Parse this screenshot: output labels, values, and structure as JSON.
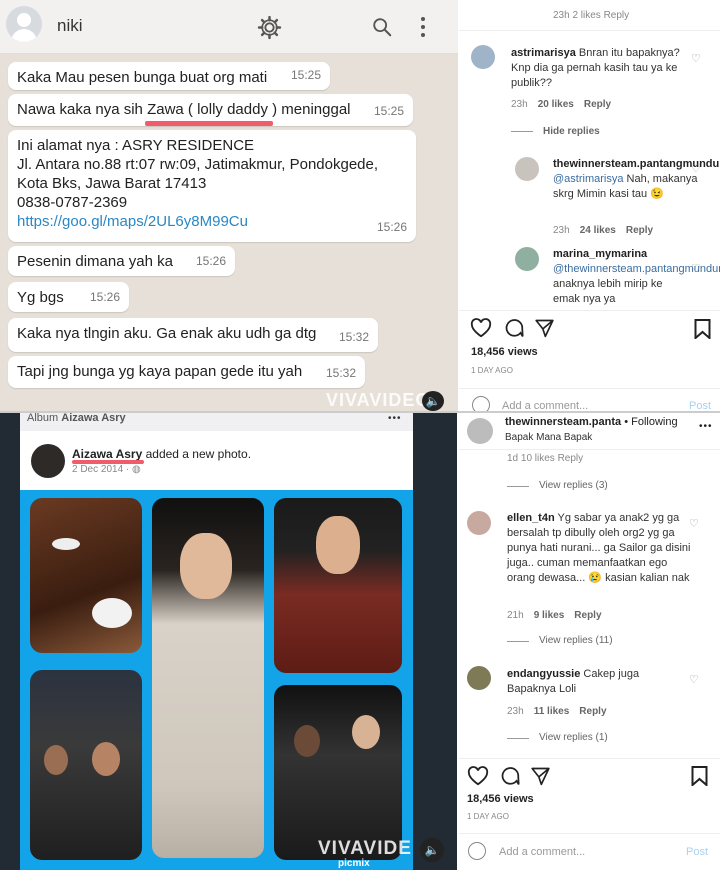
{
  "whatsapp": {
    "contact_name": "niki",
    "messages": [
      {
        "text": "Kaka Mau pesen bunga buat org mati",
        "time": "15:25"
      },
      {
        "text": "Nawa kaka nya sih Zawa ( lolly daddy ) meninggal",
        "time": "15:25"
      },
      {
        "lines": [
          "Ini alamat nya : ASRY RESIDENCE",
          "Jl. Antara no.88 rt:07 rw:09, Jatimakmur, Pondokgede,",
          "Kota Bks, Jawa Barat 17413",
          "0838-0787-2369"
        ],
        "link": "https://goo.gl/maps/2UL6y8M99Cu",
        "time": "15:26"
      },
      {
        "text": "Pesenin dimana yah ka",
        "time": "15:26"
      },
      {
        "text": "Yg bgs",
        "time": "15:26"
      },
      {
        "text": "Kaka nya tlngin aku. Ga enak aku udh ga dtg",
        "time": "15:32"
      },
      {
        "text": "Tapi jng bunga yg kaya papan gede itu yah",
        "time": "15:32"
      }
    ]
  },
  "watermark": "VIVAVIDEO",
  "watermark2": "VIVAVIDE",
  "watermark_sub": "picmix",
  "ig_top": {
    "partial_meta": "23h   2 likes   Reply",
    "comments": [
      {
        "user": "astrimarisya",
        "text": "Bnran itu bapaknya? Knp dia ga pernah kasih tau ya ke publik??",
        "time": "23h",
        "likes": "20 likes",
        "reply": "Reply"
      },
      {
        "hide": "Hide replies"
      },
      {
        "user": "thewinnersteam.pantangmundur",
        "mention": "@astrimarisya",
        "text": " Nah, makanya skrg Mimin kasi tau 😉",
        "time": "23h",
        "likes": "24 likes",
        "reply": "Reply"
      },
      {
        "user": "marina_mymarina",
        "mention": "@thewinnersteam.pantangmundur",
        "text": " anaknya lebih mirip ke emak nya ya",
        "time": "",
        "likes": "",
        "reply": ""
      }
    ],
    "views": "18,456 views",
    "date": "1 DAY AGO",
    "add_comment": "Add a comment...",
    "post": "Post"
  },
  "facebook": {
    "album": "Album ",
    "album_name": "Aizawa Asry",
    "more": "•••",
    "poster": "Aizawa Asry",
    "action": " added a new photo.",
    "date": "2 Dec 2014 · "
  },
  "ig_bottom": {
    "header_user": "thewinnersteam.panta",
    "following": " • Following",
    "subtitle": "Bapak Mana Bapak",
    "more": "•••",
    "partial_meta": "1d   10 likes   Reply",
    "view_replies_1": "View replies (3)",
    "comments": [
      {
        "user": "ellen_t4n",
        "text": " Yg sabar ya anak2 yg ga bersalah tp dibully oleh org2 yg ga punya hati nurani... ga Sailor ga disini juga.. cuman memanfaatkan ego orang dewasa... 😢 kasian kalian nak",
        "time": "21h",
        "likes": "9 likes",
        "reply": "Reply",
        "view": "View replies (11)"
      },
      {
        "user": "endangyussie",
        "text": " Cakep juga Bapaknya Loli",
        "time": "23h",
        "likes": "11 likes",
        "reply": "Reply",
        "view": "View replies (1)"
      }
    ],
    "views": "18,456 views",
    "date": "1 DAY AGO",
    "add_comment": "Add a comment...",
    "post": "Post"
  }
}
